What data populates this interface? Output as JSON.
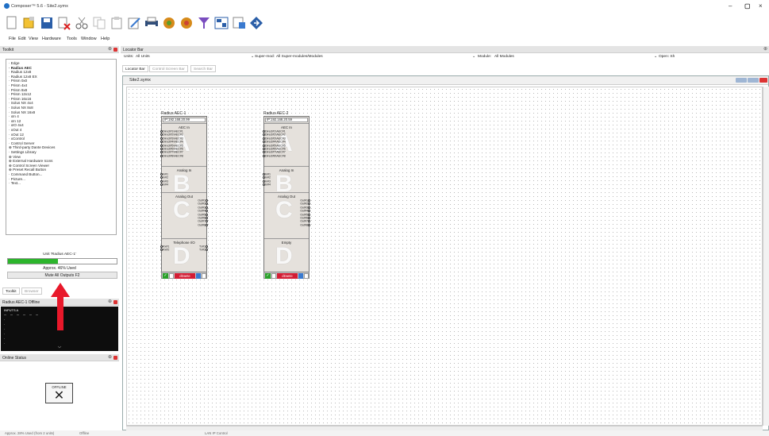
{
  "window": {
    "title": "Composer™ 5.6 - Site2.symx",
    "min": "–",
    "max": "▢",
    "close": "×"
  },
  "menu": [
    "File",
    "Edit",
    "View",
    "Hardware",
    "Tools",
    "Window",
    "Help"
  ],
  "toolkit": {
    "title": "Toolkit",
    "items": [
      "Edge",
      "Radius AEC",
      "Radius 12x8",
      "Radius 12x8 EX",
      "Prism 0x0",
      "Prism 4x4",
      "Prism 8x8",
      "Prism 12x12",
      "Prism 16x16",
      "Solus NX 4x4",
      "Solus NX 8x8",
      "Solus NX 16x8",
      "xIn 4",
      "xIn 12",
      "xIO 4x4",
      "xOut 4",
      "xOut 12",
      "xControl",
      "Control Server",
      "Third-party Dante Devices",
      "Settings Library",
      "View",
      "External Hardware Icons",
      "Control Screen Viewer",
      "Preset Recall Button",
      "Command Button...",
      "Picture...",
      "Text..."
    ],
    "unit_label": "Unit 'Radius AEC-1'",
    "usage": {
      "percent": 46,
      "text": "Approx. 46% Used"
    },
    "mute_button": "Mute All Outputs  F2",
    "tabs": [
      "Toolkit",
      "Browser"
    ]
  },
  "meter": {
    "title": "Radius AEC-1 Offline",
    "label": "INPUTS A"
  },
  "online_status": {
    "title": "Online Status",
    "badge": "OFFLINE",
    "symbol": "✕"
  },
  "locator": {
    "title": "Locator Bar",
    "units_label": "Units:",
    "units_value": "All Units",
    "supermod_label": "Super-mod:",
    "supermod_value": "All Super-modules/Modules",
    "module_label": "Module:",
    "module_value": "All Modules",
    "open_label": "Open: Sh",
    "tabs": [
      "Locator Bar",
      "Control Screen Bar",
      "Search Bar"
    ]
  },
  "document": {
    "title": "Site2.symx"
  },
  "units": [
    {
      "name": "Radius AEC-1",
      "ip": "IP:192.168.20.99",
      "sections": [
        {
          "title": "AEC In",
          "letter": "A",
          "pins": [
            "Direct#1\\AEC#1",
            "Direct#2\\AEC#2",
            "Direct#3\\AEC#3",
            "Direct#4\\AEC#4",
            "Direct#5\\AEC#5",
            "Direct#6\\AEC#6",
            "Direct#7\\AEC#7",
            "Direct#8\\AEC#8"
          ]
        },
        {
          "title": "Analog In",
          "letter": "B",
          "pins": [
            "In#1",
            "In#2",
            "In#3",
            "In#4"
          ]
        },
        {
          "title": "Analog Out",
          "letter": "C",
          "pins": [
            "Out#1",
            "Out#2",
            "Out#3",
            "Out#4",
            "Out#5",
            "Out#6",
            "Out#7",
            "Out#8"
          ]
        },
        {
          "title": "Telephone I/O",
          "letter": "D",
          "pins_in": [
            "Rx#1",
            "Rx#2"
          ],
          "pins_out": [
            "Tx#1",
            "Tx#2"
          ]
        }
      ],
      "dante": "dDante"
    },
    {
      "name": "Radius AEC-2",
      "ip": "IP:192.168.20.59",
      "sections": [
        {
          "title": "AEC In",
          "letter": "A",
          "pins": [
            "Direct#1\\AEC#1",
            "Direct#2\\AEC#2",
            "Direct#3\\AEC#3",
            "Direct#4\\AEC#4",
            "Direct#5\\AEC#5",
            "Direct#6\\AEC#6",
            "Direct#7\\AEC#7",
            "Direct#8\\AEC#8"
          ]
        },
        {
          "title": "Analog In",
          "letter": "B",
          "pins": [
            "In#1",
            "In#2",
            "In#3",
            "In#4"
          ]
        },
        {
          "title": "Analog Out",
          "letter": "C",
          "pins": [
            "Out#1",
            "Out#2",
            "Out#3",
            "Out#4",
            "Out#5",
            "Out#6",
            "Out#7",
            "Out#8"
          ]
        },
        {
          "title": "Empty",
          "letter": "D",
          "pins_in": [],
          "pins_out": []
        }
      ],
      "dante": "dDante"
    }
  ],
  "status": {
    "left": "Approx. 28% Used (from 2 units)",
    "middle": "Offline",
    "right": "LAN IP Control"
  },
  "colors": {
    "usage_bar": "#2cb52c",
    "dante": "#d31d34",
    "arrow": "#e8182a"
  }
}
